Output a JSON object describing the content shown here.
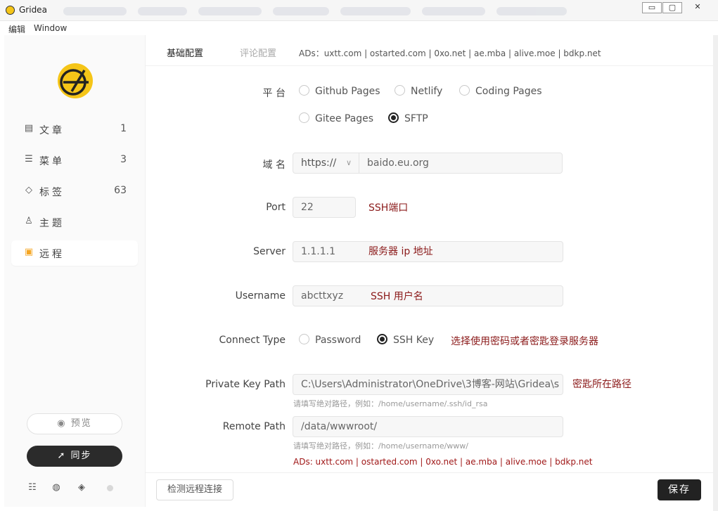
{
  "window": {
    "title": "Gridea",
    "minimize": "▭",
    "maximize": "▢",
    "close": "✕"
  },
  "menubar": {
    "edit": "编辑",
    "window": "Window"
  },
  "sidebar": {
    "items": [
      {
        "icon": "article-icon",
        "glyph": "▤",
        "label": "文章",
        "count": "1"
      },
      {
        "icon": "menu-icon",
        "glyph": "☰",
        "label": "菜单",
        "count": "3"
      },
      {
        "icon": "tag-icon",
        "glyph": "◇",
        "label": "标签",
        "count": "63"
      },
      {
        "icon": "shirt-icon",
        "glyph": "♙",
        "label": "主题",
        "count": ""
      },
      {
        "icon": "server-icon",
        "glyph": "▣",
        "label": "远程",
        "count": ""
      }
    ],
    "preview_label": "预览",
    "sync_label": "同步",
    "accent": "#f5a623"
  },
  "tabs": {
    "basic": "基础配置",
    "comment": "评论配置",
    "ads": "ADs：uxtt.com | ostarted.com | 0xo.net | ae.mba | alive.moe | bdkp.net"
  },
  "form": {
    "platform_label": "平 台",
    "platforms": [
      "Github Pages",
      "Netlify",
      "Coding Pages",
      "Gitee Pages",
      "SFTP"
    ],
    "platform_selected": "SFTP",
    "domain_label": "域 名",
    "protocol": "https://",
    "domain": "baido.eu.org",
    "port_label": "Port",
    "port": "22",
    "port_note": "SSH端口",
    "server_label": "Server",
    "server": "1.1.1.1",
    "server_note": "服务器 ip 地址",
    "username_label": "Username",
    "username": "abcttxyz",
    "username_note": "SSH 用户名",
    "connect_label": "Connect Type",
    "connect_password": "Password",
    "connect_sshkey": "SSH Key",
    "connect_note": "选择使用密码或者密匙登录服务器",
    "keypath_label": "Private Key Path",
    "keypath": "C:\\Users\\Administrator\\OneDrive\\3博客-网站\\Gridea\\s",
    "keypath_note": "密匙所在路径",
    "keypath_hint": "请填写绝对路径，例如：/home/username/.ssh/id_rsa",
    "remote_label": "Remote Path",
    "remote": "/data/wwwroot/",
    "remote_hint": "请填写绝对路径，例如：/home/username/www/",
    "ads": "ADs: uxtt.com | ostarted.com | 0xo.net | ae.mba | alive.moe | bdkp.net"
  },
  "footer": {
    "check_label": "检测远程连接",
    "save_label": "保存"
  }
}
